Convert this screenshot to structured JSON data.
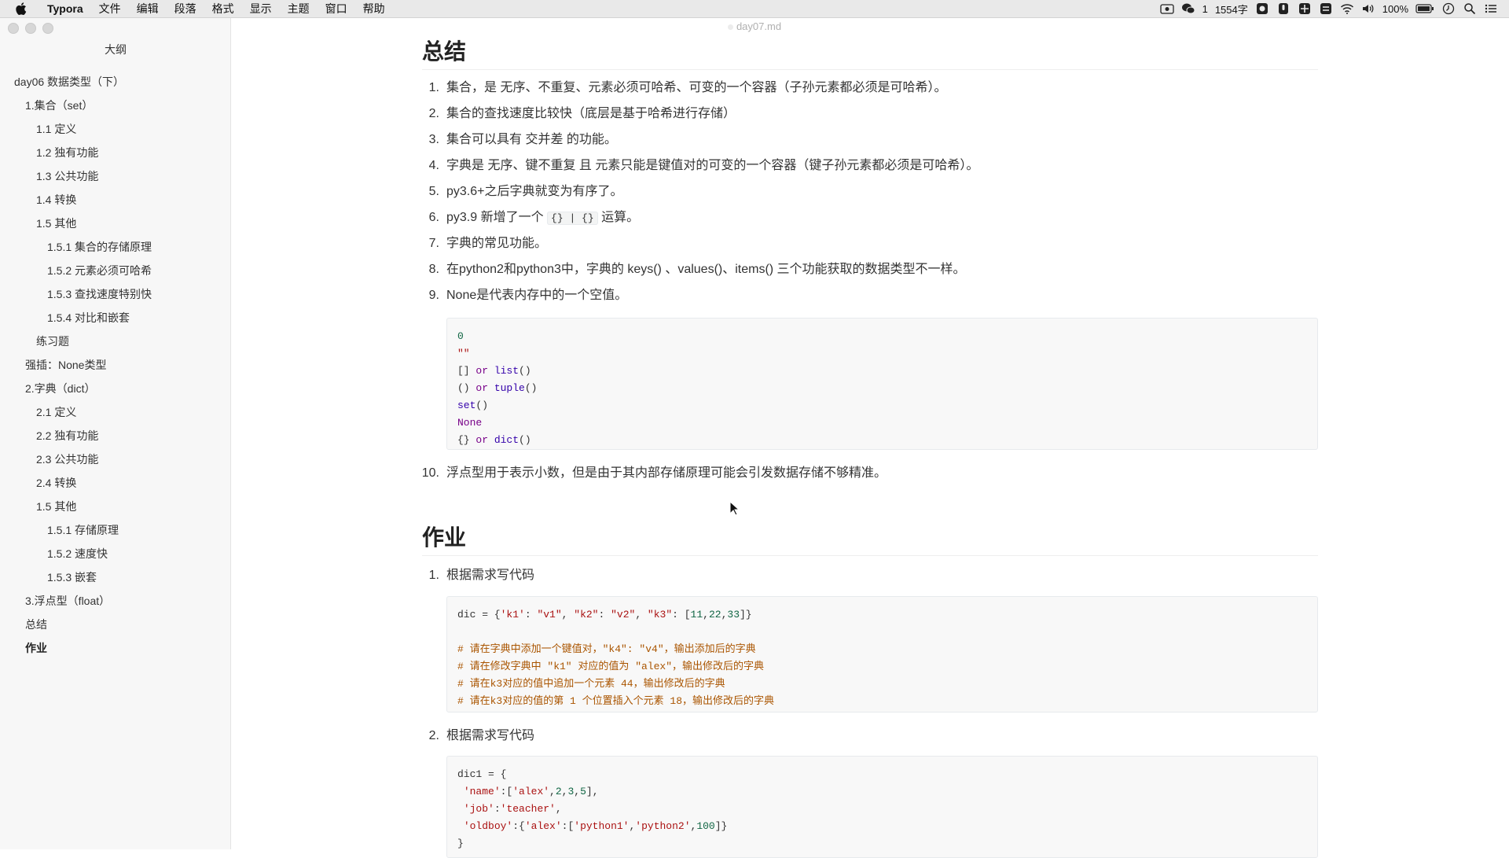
{
  "menubar": {
    "app_name": "Typora",
    "items": [
      "文件",
      "编辑",
      "段落",
      "格式",
      "显示",
      "主题",
      "窗口",
      "帮助"
    ],
    "wechat_count": "1",
    "word_count": "1554字",
    "battery": "100%"
  },
  "window": {
    "document_title": "day07.md"
  },
  "sidebar": {
    "title": "大纲",
    "items": [
      {
        "label": "day06 数据类型（下）",
        "level": 1
      },
      {
        "label": "1.集合（set）",
        "level": 2
      },
      {
        "label": "1.1 定义",
        "level": 3
      },
      {
        "label": "1.2 独有功能",
        "level": 3
      },
      {
        "label": "1.3 公共功能",
        "level": 3
      },
      {
        "label": "1.4 转换",
        "level": 3
      },
      {
        "label": "1.5 其他",
        "level": 3
      },
      {
        "label": "1.5.1 集合的存储原理",
        "level": 4
      },
      {
        "label": "1.5.2 元素必须可哈希",
        "level": 4
      },
      {
        "label": "1.5.3 查找速度特别快",
        "level": 4
      },
      {
        "label": "1.5.4 对比和嵌套",
        "level": 4
      },
      {
        "label": "练习题",
        "level": 3
      },
      {
        "label": "强插：None类型",
        "level": 2
      },
      {
        "label": "2.字典（dict）",
        "level": 2
      },
      {
        "label": "2.1 定义",
        "level": 3
      },
      {
        "label": "2.2 独有功能",
        "level": 3
      },
      {
        "label": "2.3 公共功能",
        "level": 3
      },
      {
        "label": "2.4 转换",
        "level": 3
      },
      {
        "label": "1.5 其他",
        "level": 3
      },
      {
        "label": "1.5.1 存储原理",
        "level": 4
      },
      {
        "label": "1.5.2 速度快",
        "level": 4
      },
      {
        "label": "1.5.3 嵌套",
        "level": 4
      },
      {
        "label": "3.浮点型（float）",
        "level": 2
      },
      {
        "label": "总结",
        "level": 2
      },
      {
        "label": "作业",
        "level": 2,
        "active": true
      }
    ]
  },
  "content": {
    "summary_heading": "总结",
    "summary_items": [
      "集合，是 无序、不重复、元素必须可哈希、可变的一个容器（子孙元素都必须是可哈希）。",
      "集合的查找速度比较快（底层是基于哈希进行存储）",
      "集合可以具有 交并差 的功能。",
      "字典是 无序、键不重复 且 元素只能是键值对的可变的一个容器（键子孙元素都必须是可哈希）。",
      "py3.6+之后字典就变为有序了。",
      {
        "before": "py3.9 新增了一个 ",
        "code": "{} | {}",
        "after": " 运算。"
      },
      "字典的常见功能。",
      "在python2和python3中，字典的 keys() 、values()、items() 三个功能获取的数据类型不一样。",
      "None是代表内存中的一个空值。"
    ],
    "summary_code": [
      [
        {
          "t": "0",
          "c": "num-c"
        }
      ],
      [
        {
          "t": "\"\"",
          "c": "str"
        }
      ],
      [
        {
          "t": "[] ",
          "c": ""
        },
        {
          "t": "or",
          "c": "kw"
        },
        {
          "t": " ",
          "c": ""
        },
        {
          "t": "list",
          "c": "bi"
        },
        {
          "t": "()",
          "c": ""
        }
      ],
      [
        {
          "t": "() ",
          "c": ""
        },
        {
          "t": "or",
          "c": "kw"
        },
        {
          "t": " ",
          "c": ""
        },
        {
          "t": "tuple",
          "c": "bi"
        },
        {
          "t": "()",
          "c": ""
        }
      ],
      [
        {
          "t": "set",
          "c": "bi"
        },
        {
          "t": "()",
          "c": ""
        }
      ],
      [
        {
          "t": "None",
          "c": "kw"
        }
      ],
      [
        {
          "t": "{} ",
          "c": ""
        },
        {
          "t": "or",
          "c": "kw"
        },
        {
          "t": " ",
          "c": ""
        },
        {
          "t": "dict",
          "c": "bi"
        },
        {
          "t": "()",
          "c": ""
        }
      ]
    ],
    "summary_item_10": "浮点型用于表示小数，但是由于其内部存储原理可能会引发数据存储不够精准。",
    "homework_heading": "作业",
    "homework_item_1": "根据需求写代码",
    "homework_code_1": [
      [
        {
          "t": "dic = {",
          "c": ""
        },
        {
          "t": "'k1'",
          "c": "str"
        },
        {
          "t": ": ",
          "c": ""
        },
        {
          "t": "\"v1\"",
          "c": "str"
        },
        {
          "t": ", ",
          "c": ""
        },
        {
          "t": "\"k2\"",
          "c": "str"
        },
        {
          "t": ": ",
          "c": ""
        },
        {
          "t": "\"v2\"",
          "c": "str"
        },
        {
          "t": ", ",
          "c": ""
        },
        {
          "t": "\"k3\"",
          "c": "str"
        },
        {
          "t": ": [",
          "c": ""
        },
        {
          "t": "11",
          "c": "num-c"
        },
        {
          "t": ",",
          "c": ""
        },
        {
          "t": "22",
          "c": "num-c"
        },
        {
          "t": ",",
          "c": ""
        },
        {
          "t": "33",
          "c": "num-c"
        },
        {
          "t": "]}",
          "c": ""
        }
      ],
      [
        {
          "t": "",
          "c": ""
        }
      ],
      [
        {
          "t": "# 请在字典中添加一个键值对，\"k4\": \"v4\"，输出添加后的字典",
          "c": "cmt"
        }
      ],
      [
        {
          "t": "# 请在修改字典中 \"k1\" 对应的值为 \"alex\"，输出修改后的字典",
          "c": "cmt"
        }
      ],
      [
        {
          "t": "# 请在k3对应的值中追加一个元素 44，输出修改后的字典",
          "c": "cmt"
        }
      ],
      [
        {
          "t": "# 请在k3对应的值的第 1 个位置插入个元素 18，输出修改后的字典",
          "c": "cmt"
        }
      ]
    ],
    "homework_item_2": "根据需求写代码",
    "homework_code_2": [
      [
        {
          "t": "dic1 = {",
          "c": ""
        }
      ],
      [
        {
          "t": " ",
          "c": ""
        },
        {
          "t": "'name'",
          "c": "str"
        },
        {
          "t": ":[",
          "c": ""
        },
        {
          "t": "'alex'",
          "c": "str"
        },
        {
          "t": ",",
          "c": ""
        },
        {
          "t": "2",
          "c": "num-c"
        },
        {
          "t": ",",
          "c": ""
        },
        {
          "t": "3",
          "c": "num-c"
        },
        {
          "t": ",",
          "c": ""
        },
        {
          "t": "5",
          "c": "num-c"
        },
        {
          "t": "],",
          "c": ""
        }
      ],
      [
        {
          "t": " ",
          "c": ""
        },
        {
          "t": "'job'",
          "c": "str"
        },
        {
          "t": ":",
          "c": ""
        },
        {
          "t": "'teacher'",
          "c": "str"
        },
        {
          "t": ",",
          "c": ""
        }
      ],
      [
        {
          "t": " ",
          "c": ""
        },
        {
          "t": "'oldboy'",
          "c": "str"
        },
        {
          "t": ":{",
          "c": ""
        },
        {
          "t": "'alex'",
          "c": "str"
        },
        {
          "t": ":[",
          "c": ""
        },
        {
          "t": "'python1'",
          "c": "str"
        },
        {
          "t": ",",
          "c": ""
        },
        {
          "t": "'python2'",
          "c": "str"
        },
        {
          "t": ",",
          "c": ""
        },
        {
          "t": "100",
          "c": "num-c"
        },
        {
          "t": "]}",
          "c": ""
        }
      ],
      [
        {
          "t": "}",
          "c": ""
        }
      ]
    ]
  }
}
